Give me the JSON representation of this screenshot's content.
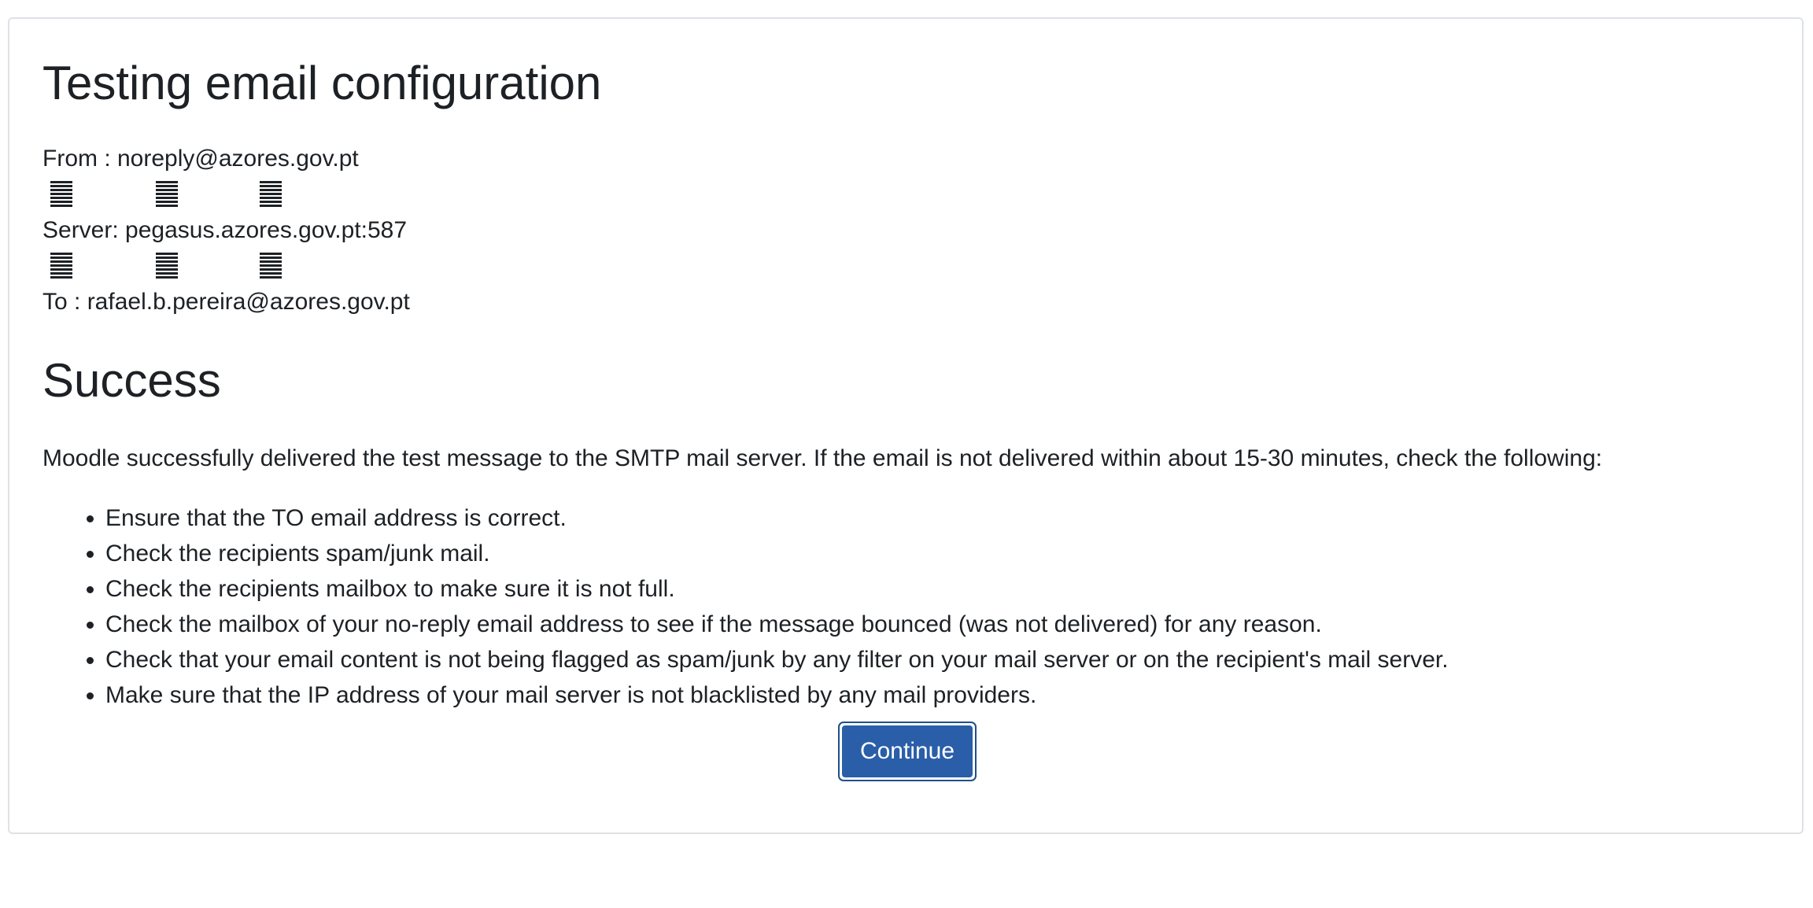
{
  "page": {
    "title": "Testing email configuration",
    "from_line": "From : noreply@azores.gov.pt",
    "server_line": "Server: pegasus.azores.gov.pt:587",
    "to_line": "To : rafael.b.pereira@azores.gov.pt",
    "glyph_icon": "unrendered-character-glyph"
  },
  "result": {
    "heading": "Success",
    "message": "Moodle successfully delivered the test message to the SMTP mail server. If the email is not delivered within about 15-30 minutes, check the following:",
    "tips": [
      "Ensure that the TO email address is correct.",
      "Check the recipients spam/junk mail.",
      "Check the recipients mailbox to make sure it is not full.",
      "Check the mailbox of your no-reply email address to see if the message bounced (was not delivered) for any reason.",
      "Check that your email content is not being flagged as spam/junk by any filter on your mail server or on the recipient's mail server.",
      "Make sure that the IP address of your mail server is not blacklisted by any mail providers."
    ]
  },
  "actions": {
    "continue_label": "Continue"
  },
  "colors": {
    "text": "#1d2125",
    "border": "#dee2e6",
    "button": "#2a5ea8",
    "button_focus_ring": "#1f4e8c"
  }
}
